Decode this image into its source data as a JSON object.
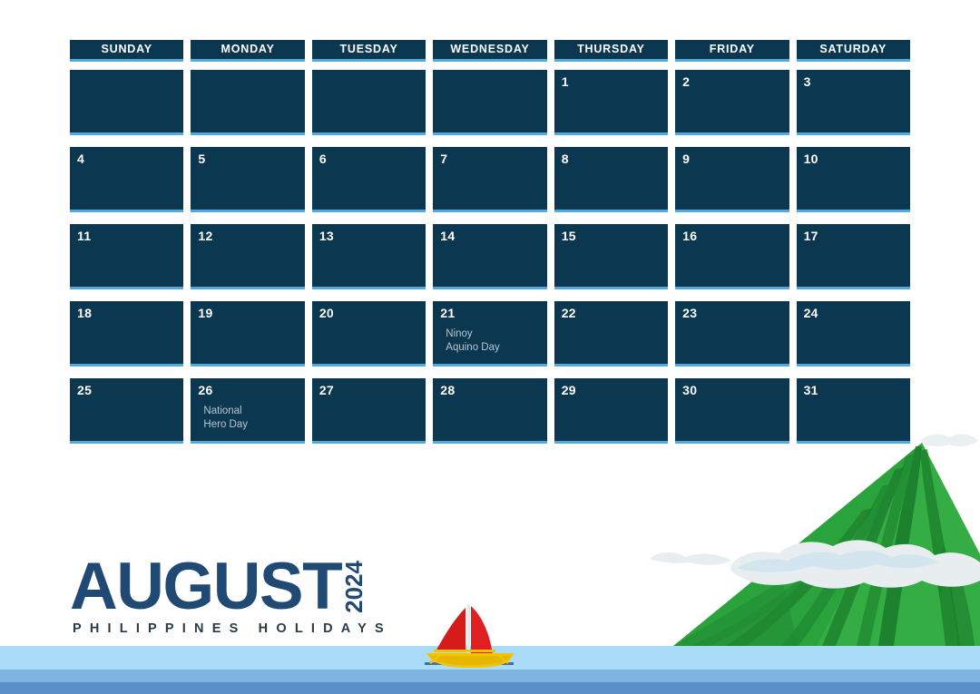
{
  "title": {
    "month": "AUGUST",
    "year": "2024",
    "subtitle": "PHILIPPINES HOLIDAYS"
  },
  "colors": {
    "cell_navy": "#0b3750",
    "cell_underline": "#53a8dd",
    "title_navy": "#204973",
    "subtitle_dark": "#2b3b46",
    "holiday_text": "#b9c6cf",
    "water_light": "#aadcf8",
    "water_mid": "#7eb4e0",
    "water_dark": "#5b8fc9",
    "volcano_green": "#2ba33c",
    "volcano_dark_green": "#1a7a2a",
    "cloud_white": "#e8eef0",
    "sail_red": "#e02020",
    "hull_yellow": "#f2c400"
  },
  "weekdays": [
    "SUNDAY",
    "MONDAY",
    "TUESDAY",
    "WEDNESDAY",
    "THURSDAY",
    "FRIDAY",
    "SATURDAY"
  ],
  "weeks": [
    [
      {
        "day": "",
        "holiday": ""
      },
      {
        "day": "",
        "holiday": ""
      },
      {
        "day": "",
        "holiday": ""
      },
      {
        "day": "",
        "holiday": ""
      },
      {
        "day": "1",
        "holiday": ""
      },
      {
        "day": "2",
        "holiday": ""
      },
      {
        "day": "3",
        "holiday": ""
      }
    ],
    [
      {
        "day": "4",
        "holiday": ""
      },
      {
        "day": "5",
        "holiday": ""
      },
      {
        "day": "6",
        "holiday": ""
      },
      {
        "day": "7",
        "holiday": ""
      },
      {
        "day": "8",
        "holiday": ""
      },
      {
        "day": "9",
        "holiday": ""
      },
      {
        "day": "10",
        "holiday": ""
      }
    ],
    [
      {
        "day": "11",
        "holiday": ""
      },
      {
        "day": "12",
        "holiday": ""
      },
      {
        "day": "13",
        "holiday": ""
      },
      {
        "day": "14",
        "holiday": ""
      },
      {
        "day": "15",
        "holiday": ""
      },
      {
        "day": "16",
        "holiday": ""
      },
      {
        "day": "17",
        "holiday": ""
      }
    ],
    [
      {
        "day": "18",
        "holiday": ""
      },
      {
        "day": "19",
        "holiday": ""
      },
      {
        "day": "20",
        "holiday": ""
      },
      {
        "day": "21",
        "holiday": "Ninoy\nAquino Day"
      },
      {
        "day": "22",
        "holiday": ""
      },
      {
        "day": "23",
        "holiday": ""
      },
      {
        "day": "24",
        "holiday": ""
      }
    ],
    [
      {
        "day": "25",
        "holiday": ""
      },
      {
        "day": "26",
        "holiday": "National\nHero Day"
      },
      {
        "day": "27",
        "holiday": ""
      },
      {
        "day": "28",
        "holiday": ""
      },
      {
        "day": "29",
        "holiday": ""
      },
      {
        "day": "30",
        "holiday": ""
      },
      {
        "day": "31",
        "holiday": ""
      }
    ]
  ],
  "scenery": {
    "volcano": "mayon-volcano-illustration",
    "clouds": "cloud-band-illustration",
    "sailboat": "red-sail-outrigger-boat",
    "water": "sea-bands-illustration"
  }
}
